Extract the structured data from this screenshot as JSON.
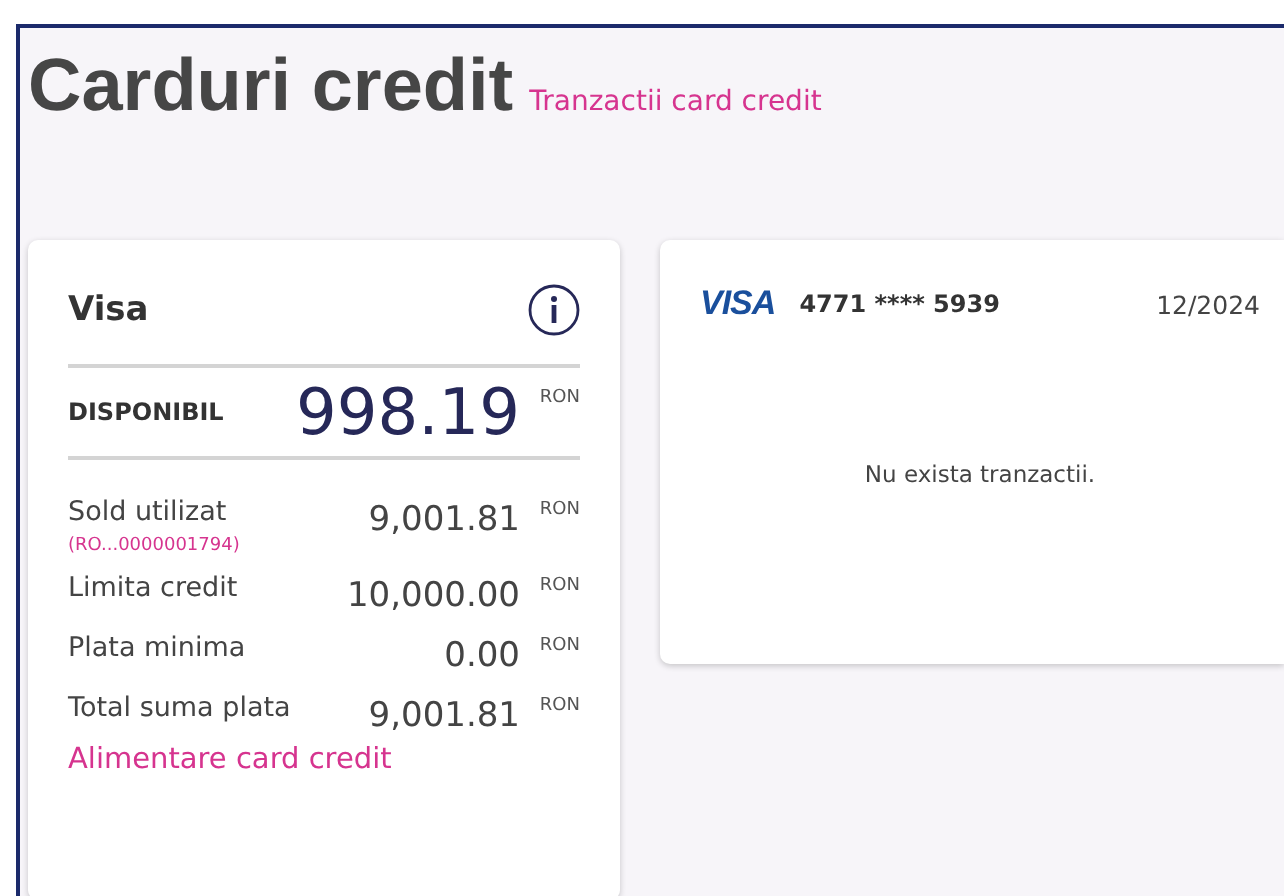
{
  "header": {
    "title": "Carduri credit",
    "link": "Tranzactii card credit"
  },
  "account_card": {
    "name": "Visa",
    "available": {
      "label": "DISPONIBIL",
      "amount": "998.19",
      "currency": "RON"
    },
    "rows": [
      {
        "label": "Sold utilizat",
        "sublabel": "(RO...0000001794)",
        "amount": "9,001.81",
        "currency": "RON"
      },
      {
        "label": "Limita credit",
        "amount": "10,000.00",
        "currency": "RON"
      },
      {
        "label": "Plata minima",
        "amount": "0.00",
        "currency": "RON"
      },
      {
        "label": "Total suma plata",
        "amount": "9,001.81",
        "currency": "RON"
      }
    ],
    "action_link": "Alimentare card credit"
  },
  "transactions_card": {
    "logo": "VISA",
    "card_number": "4771 **** 5939",
    "expiry": "12/2024",
    "empty_message": "Nu exista tranzactii."
  }
}
